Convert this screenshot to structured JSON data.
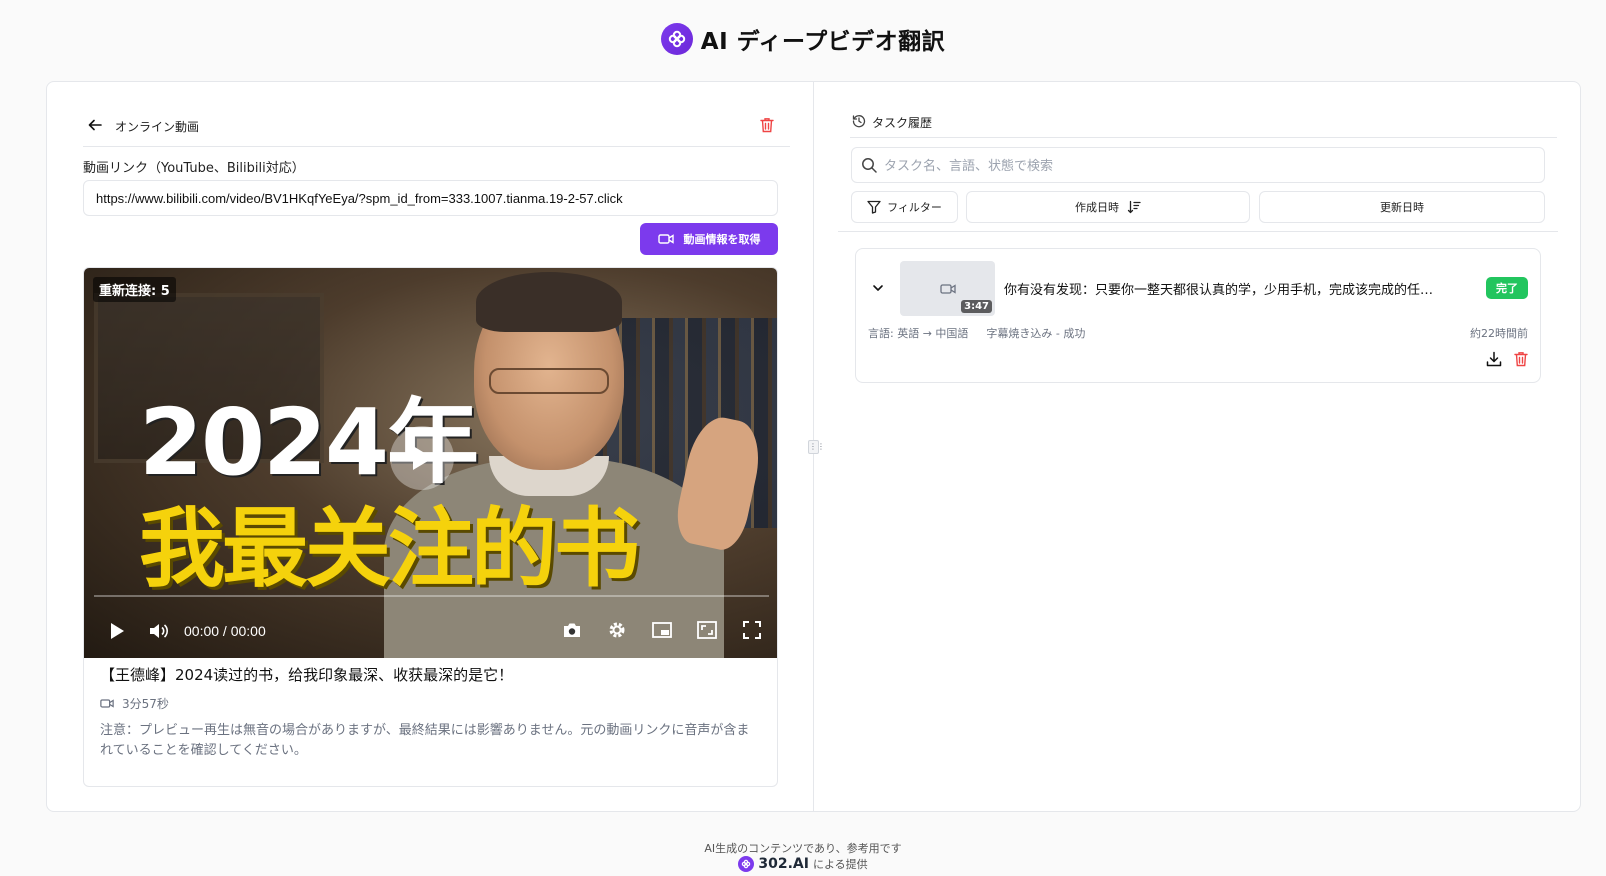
{
  "header": {
    "title": "AI ディープビデオ翻訳"
  },
  "left": {
    "heading": "オンライン動画",
    "url_label": "動画リンク（YouTube、Bilibili対応）",
    "url_value": "https://www.bilibili.com/video/BV1HKqfYeEya/?spm_id_from=333.1007.tianma.19-2-57.click",
    "fetch_button": "動画情報を取得",
    "player": {
      "reconnect_text": "重新连接: 5",
      "overlay_year": "2024年",
      "overlay_caption": "我最关注的书",
      "time": "00:00 / 00:00"
    },
    "video_title": "【王德峰】2024读过的书，给我印象最深、收获最深的是它！",
    "duration": "3分57秒",
    "note": "注意：プレビュー再生は無音の場合がありますが、最終結果には影響ありません。元の動画リンクに音声が含まれていることを確認してください。"
  },
  "right": {
    "heading": "タスク履歴",
    "search_placeholder": "タスク名、言語、状態で検索",
    "filter_label": "フィルター",
    "sort_created": "作成日時",
    "sort_updated": "更新日時",
    "tasks": [
      {
        "title": "你有没有发现：只要你一整天都很认真的学，少用手机，完成该完成的任…",
        "duration": "3:47",
        "status": "完了",
        "languages": "言語: 英語 → 中国語",
        "mode": "字幕焼き込み - 成功",
        "time": "約22時間前"
      }
    ]
  },
  "footer": {
    "disclaimer": "AI生成のコンテンツであり、参考用です",
    "brand": "302.AI",
    "provided_by": "による提供"
  },
  "colors": {
    "accent": "#7c3aed",
    "success": "#22c55e",
    "danger": "#ef4444"
  }
}
